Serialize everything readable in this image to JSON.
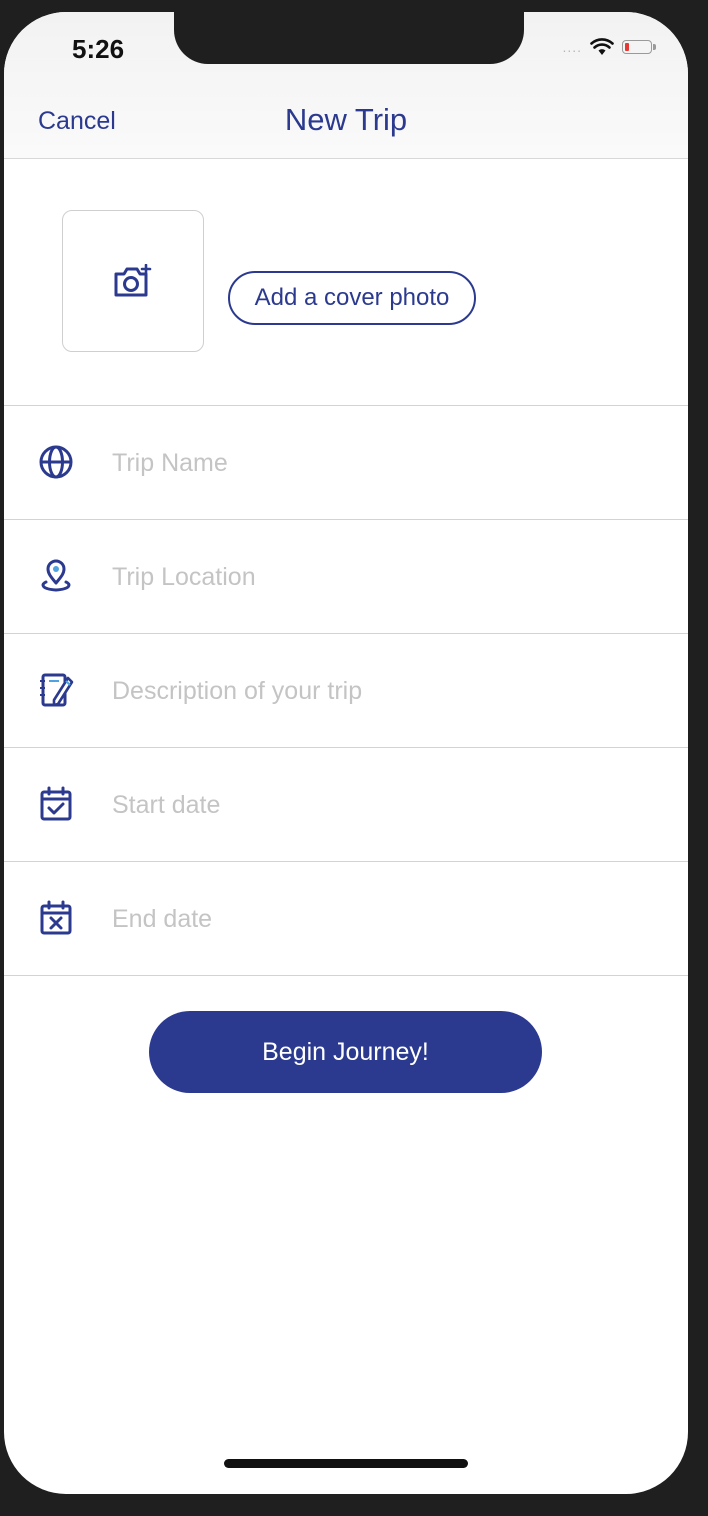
{
  "status_bar": {
    "time": "5:26",
    "signal": "....",
    "colors": {
      "battery_level": "#e53935"
    }
  },
  "nav": {
    "cancel_label": "Cancel",
    "title": "New Trip"
  },
  "cover": {
    "button_label": "Add a cover photo",
    "icon": "camera-add-icon"
  },
  "fields": [
    {
      "placeholder": "Trip Name",
      "icon": "globe-icon"
    },
    {
      "placeholder": "Trip Location",
      "icon": "location-pin-icon"
    },
    {
      "placeholder": "Description of your trip",
      "icon": "notebook-pencil-icon"
    },
    {
      "placeholder": "Start date",
      "icon": "calendar-check-icon"
    },
    {
      "placeholder": "End date",
      "icon": "calendar-x-icon"
    }
  ],
  "submit": {
    "label": "Begin Journey!"
  },
  "colors": {
    "accent": "#2b3a8f",
    "placeholder": "#c4c4c4",
    "divider": "#d3d3d3",
    "light_blue": "#4fa3e0"
  }
}
